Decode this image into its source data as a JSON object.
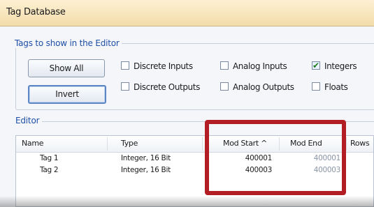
{
  "window": {
    "title": "Tag Database"
  },
  "tags_group": {
    "label": "Tags to show in the Editor",
    "buttons": {
      "show_all": "Show All",
      "invert": "Invert"
    },
    "checkboxes": [
      {
        "label": "Discrete Inputs",
        "checked": false
      },
      {
        "label": "Analog Inputs",
        "checked": false
      },
      {
        "label": "Integers",
        "checked": true
      },
      {
        "label": "Discrete Outputs",
        "checked": false
      },
      {
        "label": "Analog Outputs",
        "checked": false
      },
      {
        "label": "Floats",
        "checked": false
      }
    ]
  },
  "editor": {
    "label": "Editor",
    "columns": [
      "Name",
      "Type",
      "Mod Start ^",
      "Mod End",
      "Rows"
    ],
    "rows": [
      {
        "name": "Tag 1",
        "type": "Integer, 16 Bit",
        "mod_start": "400001",
        "mod_end": "400001"
      },
      {
        "name": "Tag 2",
        "type": "Integer, 16 Bit",
        "mod_start": "400003",
        "mod_end": "400003"
      }
    ]
  },
  "colors": {
    "titlebar": "#f2dcaa",
    "group_label": "#1e4fa6",
    "highlight_box": "#b31e24",
    "check": "#1c7a1c"
  }
}
